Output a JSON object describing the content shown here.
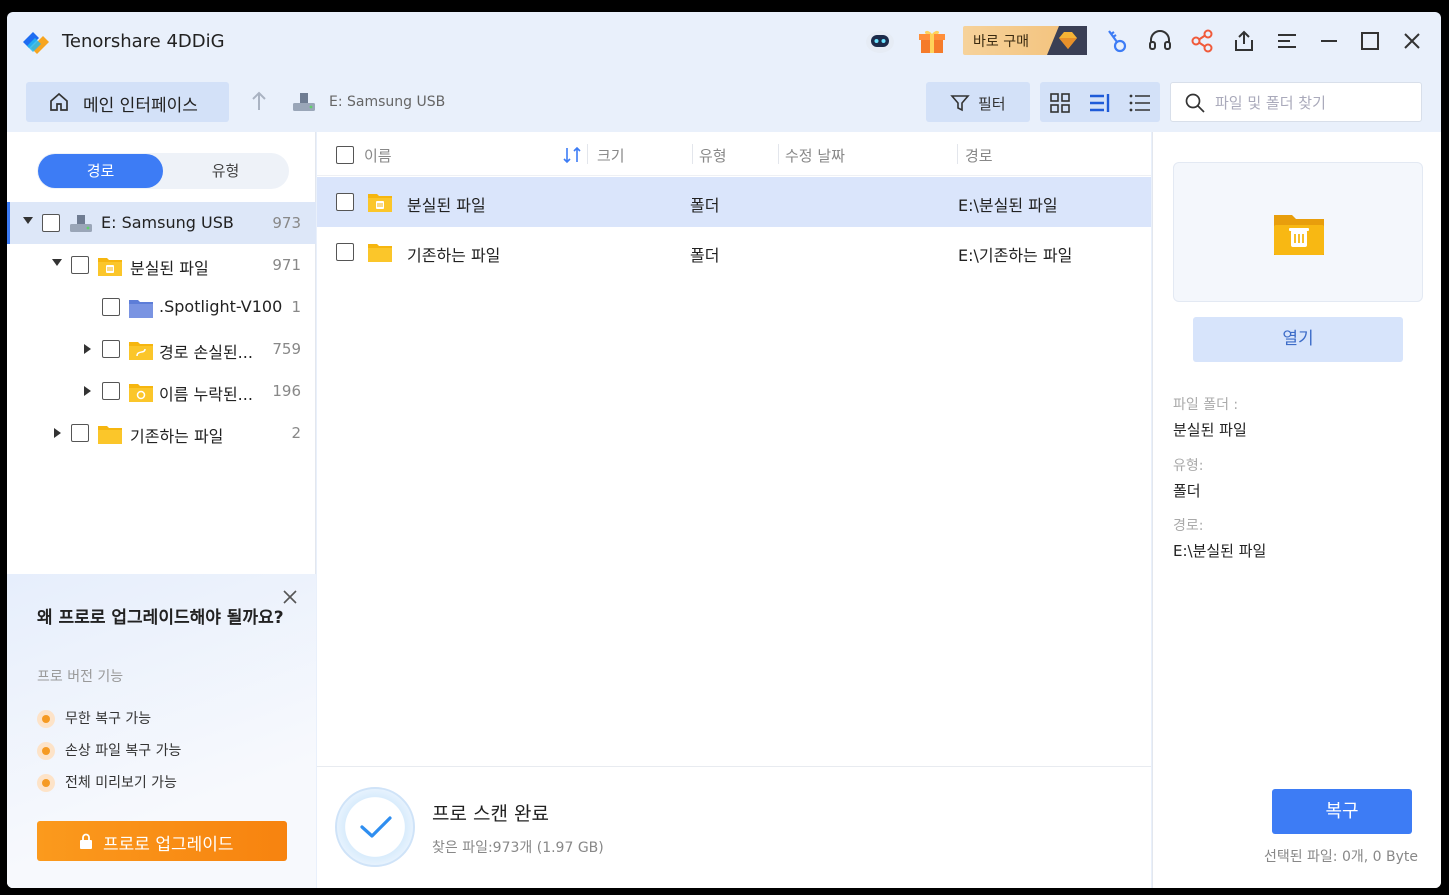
{
  "app": {
    "title": "Tenorshare 4DDiG",
    "buy_label": "바로 구매"
  },
  "icons": {
    "logo": "4ddig-logo-icon",
    "robot": "robot-assistant-icon",
    "gift": "gift-icon",
    "gem": "diamond-gem-icon",
    "key": "key-icon",
    "headset": "headset-icon",
    "share": "share-icon",
    "export": "export-icon",
    "menu": "menu-icon",
    "minimize": "minimize-icon",
    "maximize": "maximize-icon",
    "close": "close-icon"
  },
  "toolbar": {
    "home_label": "메인 인터페이스",
    "breadcrumb": "E: Samsung USB",
    "filter_label": "필터",
    "search_placeholder": "파일 및 폴더 찾기"
  },
  "left": {
    "tabs": [
      "경로",
      "유형"
    ],
    "active_tab": 0,
    "tree": [
      {
        "name": "E: Samsung USB",
        "count": "973",
        "level": 0,
        "expanded": true,
        "icon": "usb-drive-icon"
      },
      {
        "name": "분실된 파일",
        "count": "971",
        "level": 1,
        "expanded": true,
        "icon": "lost-folder-icon"
      },
      {
        "name": ".Spotlight-V100",
        "count": "1",
        "level": 2,
        "expanded": null,
        "icon": "blue-folder-icon"
      },
      {
        "name": "경로 손실된...",
        "count": "759",
        "level": 2,
        "expanded": false,
        "icon": "path-lost-folder-icon"
      },
      {
        "name": "이름 누락된...",
        "count": "196",
        "level": 2,
        "expanded": false,
        "icon": "name-lost-folder-icon"
      },
      {
        "name": "기존하는 파일",
        "count": "2",
        "level": 1,
        "expanded": false,
        "icon": "folder-icon"
      }
    ]
  },
  "promo": {
    "title": "왜 프로로 업그레이드해야 될까요?",
    "subtitle": "프로 버전 기능",
    "features": [
      "무한 복구 가능",
      "손상 파일 복구 가능",
      "전체 미리보기 가능"
    ],
    "button": "프로로 업그레이드"
  },
  "table": {
    "headers": {
      "name": "이름",
      "size": "크기",
      "type": "유형",
      "modified": "수정 날짜",
      "path": "경로"
    },
    "rows": [
      {
        "name": "분실된 파일",
        "size": "",
        "type": "폴더",
        "modified": "",
        "path": "E:\\분실된 파일",
        "selected": true
      },
      {
        "name": "기존하는 파일",
        "size": "",
        "type": "폴더",
        "modified": "",
        "path": "E:\\기존하는 파일",
        "selected": false
      }
    ]
  },
  "footer": {
    "status_title": "프로 스캔 완료",
    "status_sub": "찾은 파일:973개 (1.97 GB)",
    "recover_label": "복구",
    "selected_info": "선택된 파일: 0개, 0 Byte"
  },
  "details": {
    "open_label": "열기",
    "folder_label": "파일 폴더 :",
    "folder_value": "분실된 파일",
    "type_label": "유형:",
    "type_value": "폴더",
    "path_label": "경로:",
    "path_value": "E:\\분실된 파일"
  },
  "colors": {
    "accent": "#3d7cf5",
    "orange": "#f7830f",
    "folder": "#f6b60f"
  }
}
